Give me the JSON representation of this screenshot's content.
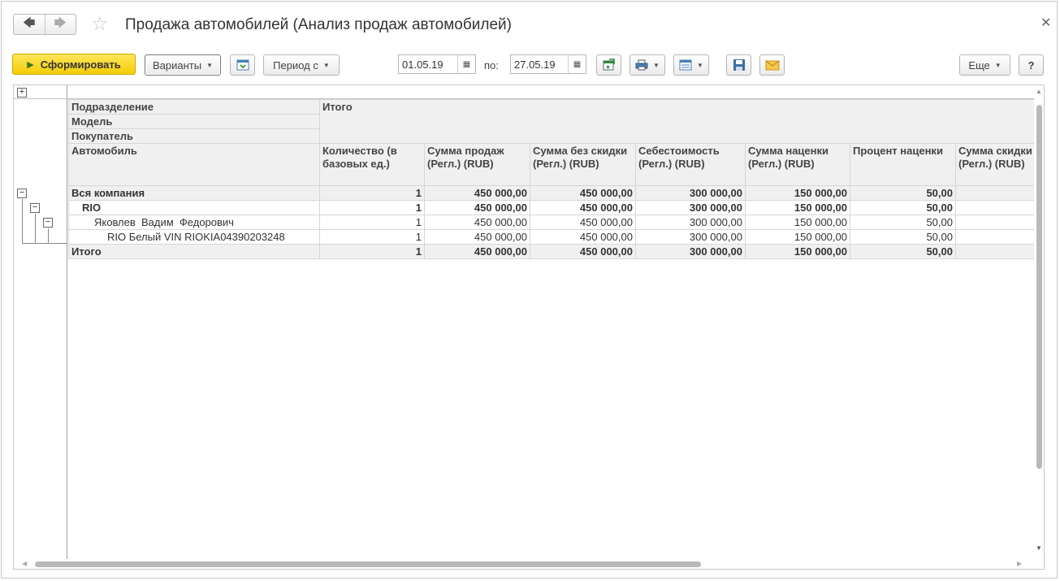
{
  "window": {
    "title": "Продажа автомобилей (Анализ продаж автомобилей)"
  },
  "toolbar": {
    "generate_label": "Сформировать",
    "variants_label": "Варианты",
    "period_label": "Период с",
    "date_from": "01.05.19",
    "to_label": "по:",
    "date_to": "27.05.19",
    "more_label": "Еще",
    "help_label": "?"
  },
  "report": {
    "grouping_headers": [
      "Подразделение",
      "Модель",
      "Покупатель",
      "Автомобиль"
    ],
    "total_header": "Итого",
    "columns": [
      "Количество (в базовых ед.)",
      "Сумма продаж (Регл.) (RUB)",
      "Сумма без скидки (Регл.) (RUB)",
      "Себестоимость (Регл.) (RUB)",
      "Сумма наценки (Регл.) (RUB)",
      "Процент наценки",
      "Сумма скидки (Регл.) (RUB)"
    ],
    "rows": [
      {
        "label": "Вся компания",
        "qty": "1",
        "sales": "450 000,00",
        "no_discount": "450 000,00",
        "cost": "300 000,00",
        "markup": "150 000,00",
        "markup_pct": "50,00",
        "discount": ""
      },
      {
        "label": "RIO",
        "qty": "1",
        "sales": "450 000,00",
        "no_discount": "450 000,00",
        "cost": "300 000,00",
        "markup": "150 000,00",
        "markup_pct": "50,00",
        "discount": ""
      },
      {
        "label": "Яковлев  Вадим  Федорович",
        "qty": "1",
        "sales": "450 000,00",
        "no_discount": "450 000,00",
        "cost": "300 000,00",
        "markup": "150 000,00",
        "markup_pct": "50,00",
        "discount": ""
      },
      {
        "label": "RIO Белый VIN RIOKIA04390203248",
        "qty": "1",
        "sales": "450 000,00",
        "no_discount": "450 000,00",
        "cost": "300 000,00",
        "markup": "150 000,00",
        "markup_pct": "50,00",
        "discount": ""
      },
      {
        "label": "Итого",
        "qty": "1",
        "sales": "450 000,00",
        "no_discount": "450 000,00",
        "cost": "300 000,00",
        "markup": "150 000,00",
        "markup_pct": "50,00",
        "discount": ""
      }
    ]
  },
  "icons": {
    "back": "arrow-left-icon",
    "forward": "arrow-right-icon",
    "favorite": "star-icon",
    "close": "close-icon"
  },
  "colors": {
    "primary_button": "#f4cc05",
    "header_bg": "#f0f0f0"
  }
}
